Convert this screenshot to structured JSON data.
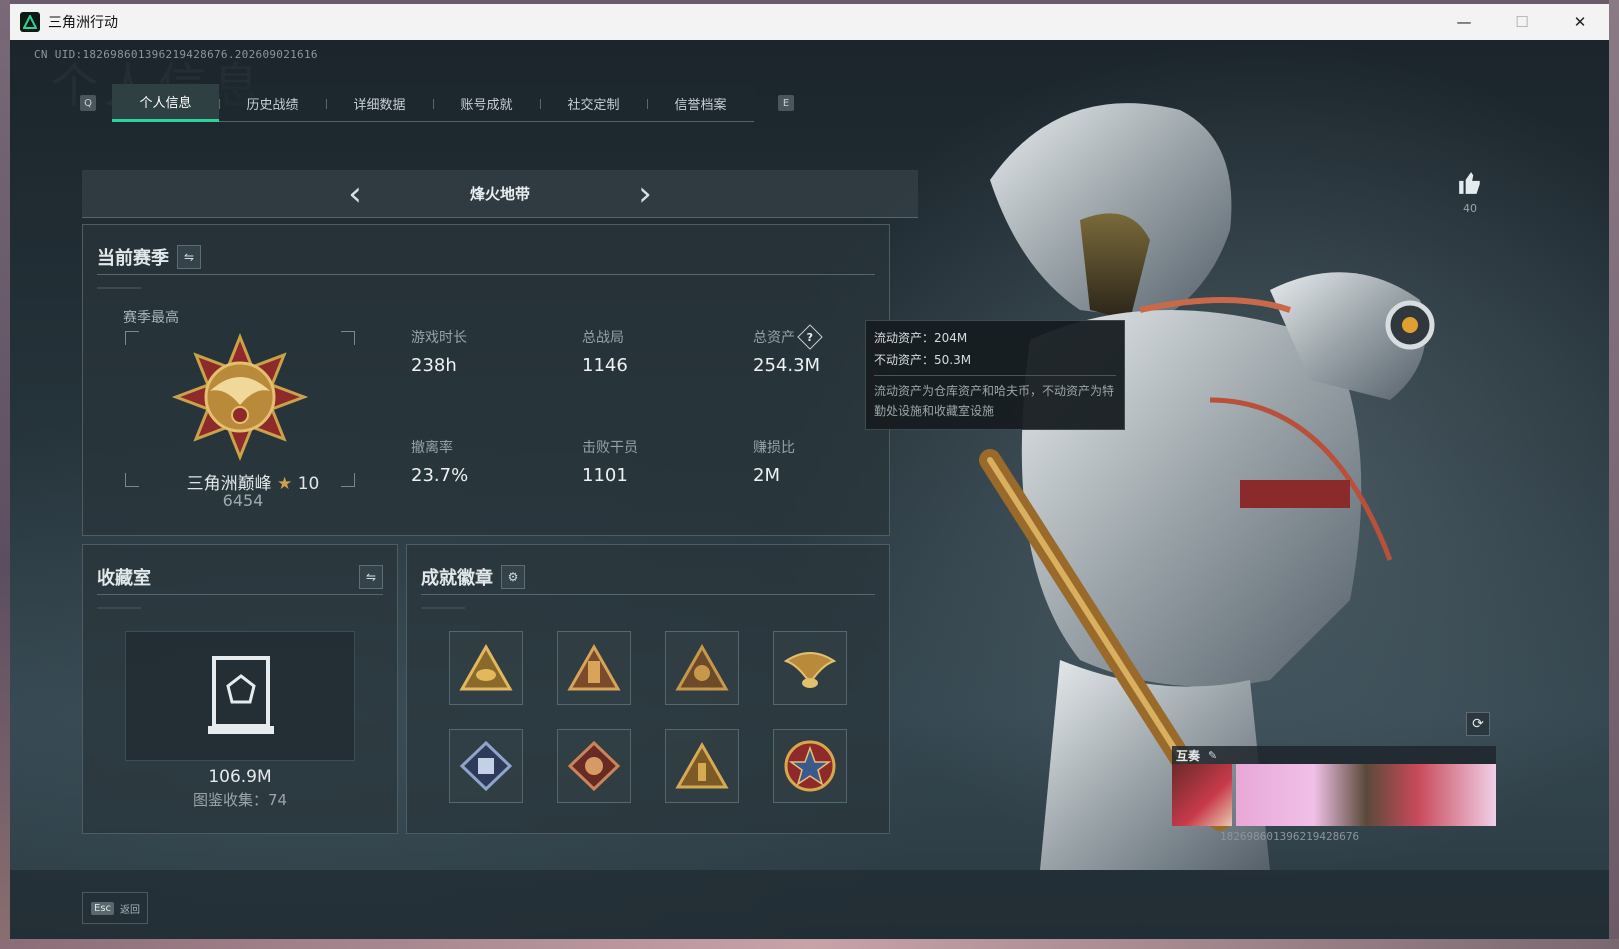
{
  "window": {
    "title": "三角洲行动",
    "controls": {
      "minimize": "—",
      "maximize": "☐",
      "close": "✕"
    }
  },
  "uid_top": "CN UID:1826986013962194286​76.20260902161​6",
  "background_watermark": "个人信息",
  "tabs": {
    "left_key": "Q",
    "right_key": "E",
    "items": [
      {
        "label": "个人信息",
        "active": true
      },
      {
        "label": "历史战绩",
        "active": false
      },
      {
        "label": "详细数据",
        "active": false
      },
      {
        "label": "账号成就",
        "active": false
      },
      {
        "label": "社交定制",
        "active": false
      },
      {
        "label": "信誉档案",
        "active": false
      }
    ]
  },
  "mode_selector": {
    "prev": "‹",
    "label": "烽火地带",
    "next": "›"
  },
  "season": {
    "title": "当前赛季",
    "swap_icon": "swap-icon",
    "best_label": "赛季最高",
    "rank_name": "三角洲巅峰",
    "rank_star": "★",
    "rank_level": "10",
    "rank_score": "6454",
    "stats": [
      {
        "label": "游戏时长",
        "value": "238h"
      },
      {
        "label": "总战局",
        "value": "1146"
      },
      {
        "label": "总资产",
        "value": "254.3M",
        "help": "?"
      },
      {
        "label": "撤离率",
        "value": "23.7%"
      },
      {
        "label": "击败干员",
        "value": "1101"
      },
      {
        "label": "赚损比",
        "value": "2M"
      }
    ]
  },
  "tooltip": {
    "liquid": "流动资产：204M",
    "fixed": "不动资产：50.3M",
    "description": "流动资产为仓库资产和哈夫币，不动资产为特勤处设施和收藏室设施"
  },
  "collection": {
    "title": "收藏室",
    "value": "106.9M",
    "count_label": "图鉴收集：74"
  },
  "achievements": {
    "title": "成就徽章",
    "settings_icon": "gear-icon",
    "badges": [
      "triangle-eye-badge",
      "triangle-tower-badge",
      "triangle-skull-badge",
      "eagle-crest-badge",
      "cube-diamond-badge",
      "dragon-diamond-badge",
      "triangle-soldier-badge",
      "star-shield-badge"
    ]
  },
  "bottom": {
    "esc_key": "Esc",
    "esc_label": "返回"
  },
  "profile": {
    "like_count": "40",
    "duo_label": "互奏",
    "duo_edit": "✎",
    "duo_uid": "1826986013962194286​76"
  },
  "colors": {
    "accent": "#2fd19a",
    "gold": "#c9a24a",
    "panel": "#28343a"
  }
}
